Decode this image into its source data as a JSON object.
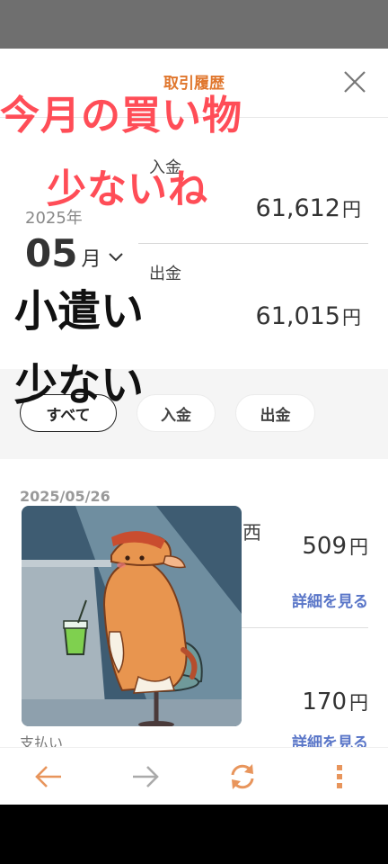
{
  "header": {
    "title": "取引履歴"
  },
  "period": {
    "year": "2025年",
    "month_num": "05",
    "month_unit": "月"
  },
  "summary": {
    "income_label": "入金",
    "income_value": "61,612",
    "income_unit": "円",
    "expense_label": "出金",
    "expense_value": "61,015",
    "expense_unit": "円"
  },
  "filters": [
    "すべて",
    "入金",
    "出金"
  ],
  "transactions": [
    {
      "date": "2025/05/26",
      "fragment": "西",
      "amount": "509",
      "unit": "円",
      "detail_label": "詳細を見る"
    },
    {
      "amount": "170",
      "unit": "円",
      "detail_label": "詳細を見る",
      "sub": "支払い"
    }
  ],
  "overlay_text": {
    "line1": "今月の買い物",
    "line2": "少ないね",
    "line3": "小遣い",
    "line4": "少ない"
  },
  "colors": {
    "accent": "#e0772e",
    "link": "#5a76c8",
    "overlay_red": "#ff4d57"
  },
  "nav_icons": [
    "arrow-left-icon",
    "arrow-right-icon",
    "refresh-icon",
    "more-vertical-icon"
  ]
}
